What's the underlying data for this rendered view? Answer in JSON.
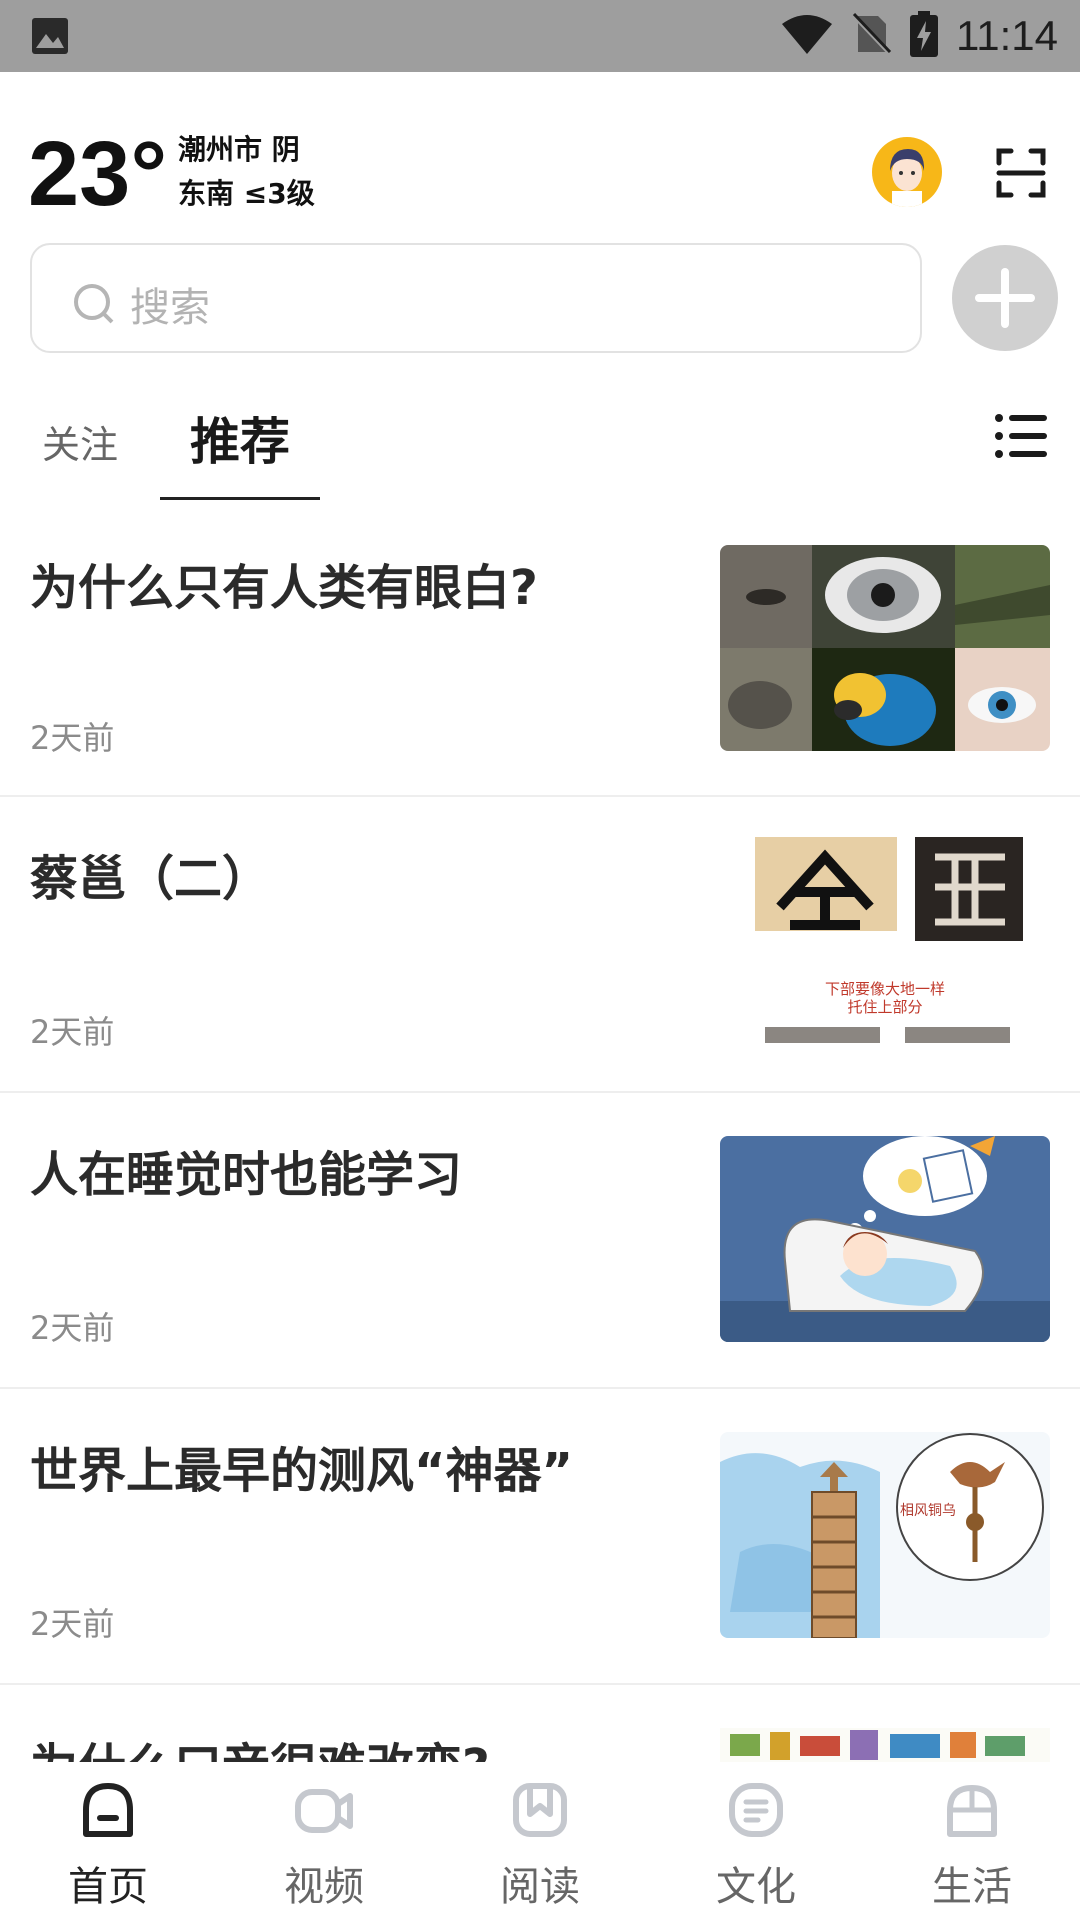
{
  "status_bar": {
    "time": "11:14"
  },
  "weather": {
    "temperature": "23°",
    "line1": "潮州市 阴",
    "line2": "东南 ≤3级"
  },
  "search": {
    "placeholder": "搜索"
  },
  "tabs": [
    {
      "label": "关注",
      "active": false
    },
    {
      "label": "推荐",
      "active": true
    }
  ],
  "feed": [
    {
      "title": "为什么只有人类有眼白?",
      "time": "2天前"
    },
    {
      "title": "蔡邕（二）",
      "time": "2天前"
    },
    {
      "title": "人在睡觉时也能学习",
      "time": "2天前"
    },
    {
      "title": "世界上最早的测风“神器”",
      "time": "2天前"
    },
    {
      "title": "为什么口音很难改变?",
      "time": ""
    }
  ],
  "thumbs": {
    "calligraphy_caption_1": "下部要像大地一样",
    "calligraphy_caption_2": "托住上部分",
    "bird_label": "相风铜乌"
  },
  "bottom_nav": [
    {
      "label": "首页",
      "icon": "home-icon",
      "active": true
    },
    {
      "label": "视频",
      "icon": "video-icon",
      "active": false
    },
    {
      "label": "阅读",
      "icon": "book-icon",
      "active": false
    },
    {
      "label": "文化",
      "icon": "culture-icon",
      "active": false
    },
    {
      "label": "生活",
      "icon": "life-icon",
      "active": false
    }
  ],
  "colors": {
    "accent": "#222222",
    "inactive": "#c5c8ce",
    "status_bar": "#9e9e9e"
  }
}
